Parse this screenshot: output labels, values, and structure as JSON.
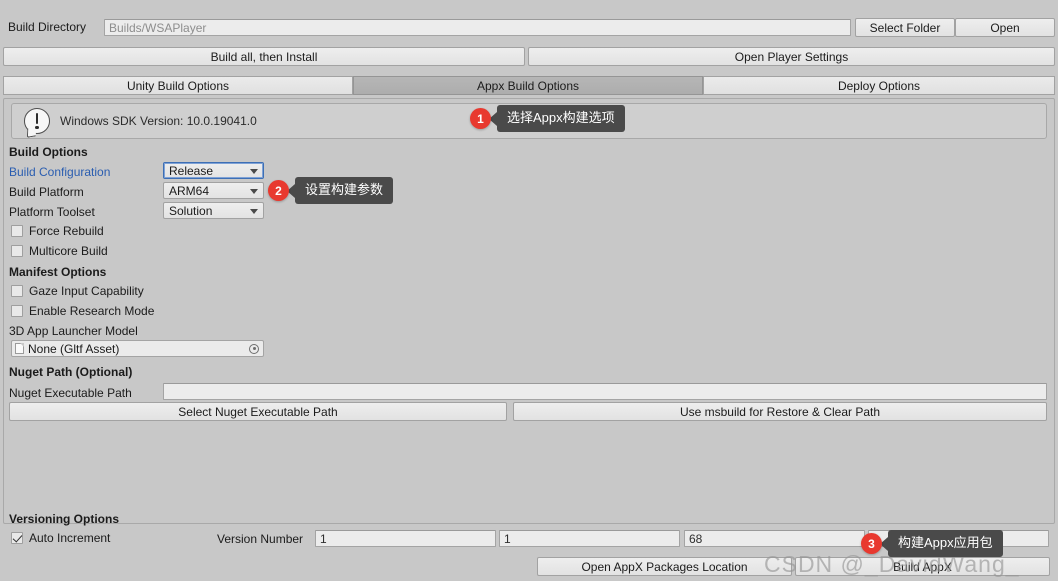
{
  "build_directory": {
    "label": "Build Directory",
    "value": "Builds/WSAPlayer",
    "select_folder_label": "Select Folder",
    "open_label": "Open"
  },
  "top_buttons": {
    "build_all_label": "Build all, then Install",
    "open_player_settings_label": "Open Player Settings"
  },
  "tabs": [
    {
      "label": "Unity Build Options",
      "selected": false
    },
    {
      "label": "Appx Build Options",
      "selected": true
    },
    {
      "label": "Deploy Options",
      "selected": false
    }
  ],
  "helpbox": {
    "icon": "info-speech-bubble-icon",
    "text": "Windows SDK Version: 10.0.19041.0"
  },
  "build_options": {
    "heading": "Build Options",
    "rows": [
      {
        "label": "Build Configuration",
        "value": "Release",
        "link": true,
        "focused": true
      },
      {
        "label": "Build Platform",
        "value": "ARM64",
        "link": false,
        "focused": false
      },
      {
        "label": "Platform Toolset",
        "value": "Solution",
        "link": false,
        "focused": false
      }
    ],
    "checkboxes": [
      {
        "label": "Force Rebuild",
        "checked": false
      },
      {
        "label": "Multicore Build",
        "checked": false
      }
    ]
  },
  "manifest_options": {
    "heading": "Manifest Options",
    "checkboxes": [
      {
        "label": "Gaze Input Capability",
        "checked": false
      },
      {
        "label": "Enable Research Mode",
        "checked": false
      }
    ],
    "launcher_model_label": "3D App Launcher Model",
    "launcher_model_value": "None (Gltf Asset)"
  },
  "nuget": {
    "heading": "Nuget Path (Optional)",
    "path_label": "Nuget Executable Path",
    "path_value": "",
    "select_button_label": "Select Nuget Executable Path",
    "msbuild_button_label": "Use msbuild for Restore & Clear Path"
  },
  "versioning": {
    "heading": "Versioning Options",
    "auto_increment_label": "Auto Increment",
    "auto_increment_checked": true,
    "version_number_label": "Version Number",
    "version_parts": [
      "1",
      "1",
      "68",
      ""
    ]
  },
  "bottom_buttons": {
    "open_packages_label": "Open AppX Packages Location",
    "build_appx_label": "Build AppX"
  },
  "annotations": [
    {
      "num": "1",
      "text": "选择Appx构建选项"
    },
    {
      "num": "2",
      "text": "设置构建参数"
    },
    {
      "num": "3",
      "text": "构建Appx应用包"
    }
  ],
  "watermark": {
    "text": "CSDN @_DavidWang_"
  },
  "colors": {
    "background": "#c8c8c8",
    "accent_red": "#e8392f",
    "callout_gray": "#4a4a4a",
    "link_blue": "#2a5db0"
  }
}
